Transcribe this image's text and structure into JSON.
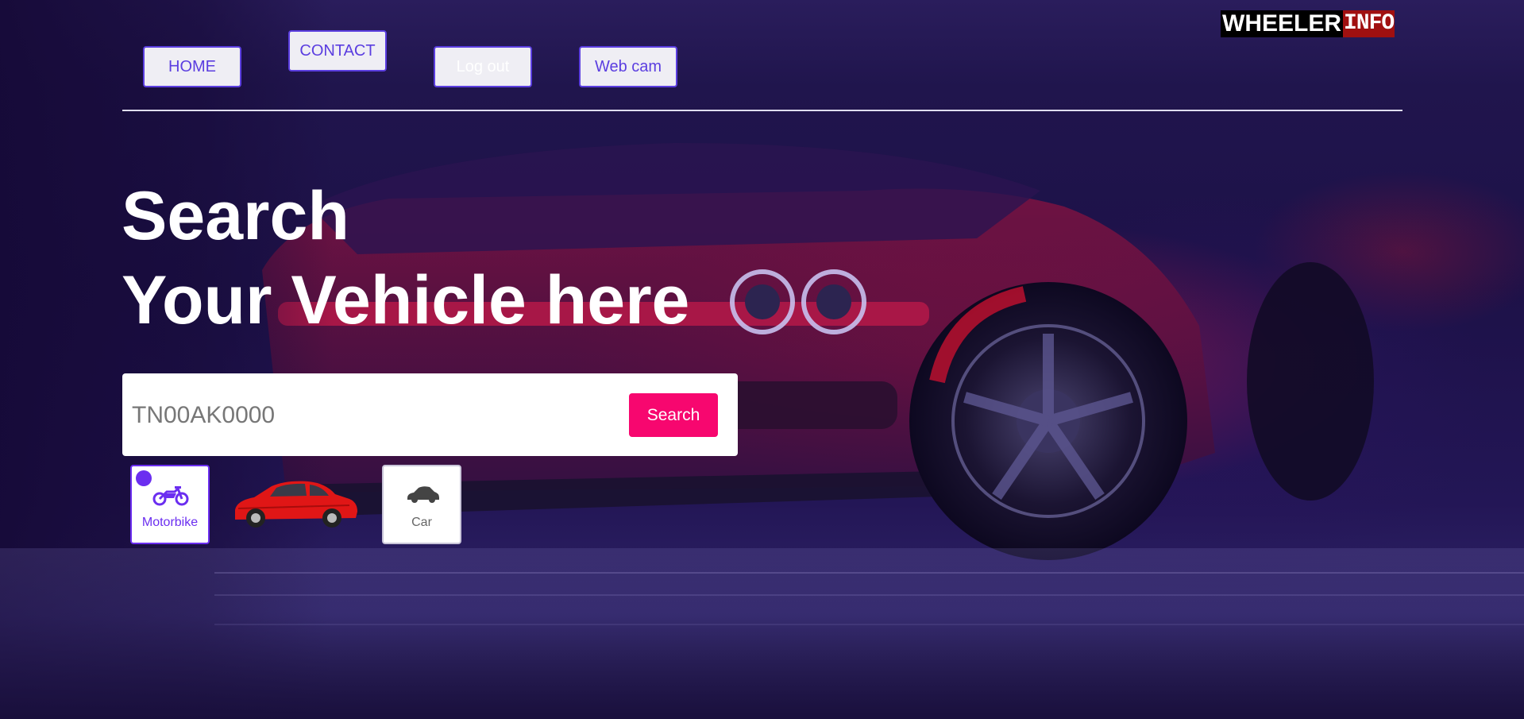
{
  "logo": {
    "part1": "WHEELER",
    "part2": "INFO",
    "colors": {
      "part1_bg": "#000000",
      "part2_bg": "#a01010"
    }
  },
  "nav": {
    "home": "HOME",
    "contact": "CONTACT",
    "logout": "Log out",
    "webcam": "Web cam"
  },
  "hero": {
    "line1": "Search",
    "line2": "Your Vehicle here"
  },
  "search": {
    "placeholder": "TN00AK0000",
    "value": "",
    "button": "Search"
  },
  "vehicle_types": [
    {
      "label": "Motorbike",
      "icon": "motorbike-icon",
      "selected": true
    },
    {
      "label": "Car",
      "icon": "car-icon",
      "selected": false
    }
  ],
  "colors": {
    "accent": "#6b2ef0",
    "nav_border": "#5b3ee0",
    "search_button": "#f7076f",
    "background": "#1d1148"
  }
}
